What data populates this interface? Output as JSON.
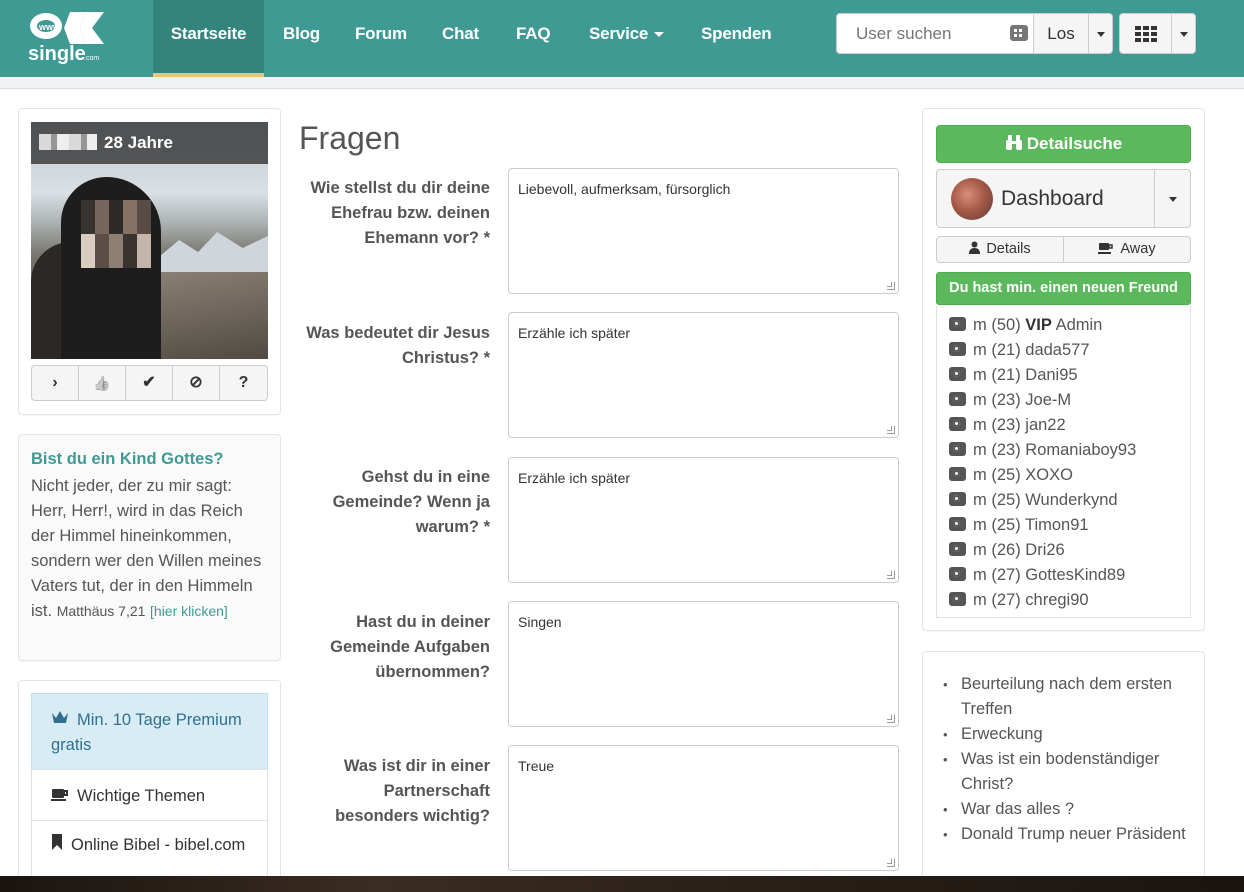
{
  "nav": {
    "logo_text": "single",
    "logo_badge": "www",
    "logo_suffix": ".com",
    "items": [
      {
        "label": "Startseite",
        "active": true
      },
      {
        "label": "Blog"
      },
      {
        "label": "Forum"
      },
      {
        "label": "Chat"
      },
      {
        "label": "FAQ"
      },
      {
        "label": "Service"
      },
      {
        "label": "Spenden"
      }
    ],
    "search": {
      "placeholder": "User suchen",
      "button": "Los"
    }
  },
  "profile": {
    "age": "28 Jahre",
    "actions": [
      "›",
      "👍",
      "✔",
      "⊘",
      "?"
    ]
  },
  "bible": {
    "title": "Bist du ein Kind Gottes?",
    "text": "Nicht jeder, der zu mir sagt: Herr, Herr!, wird in das Reich der Himmel hineinkommen, sondern wer den Willen meines Vaters tut, der in den Himmeln ist.",
    "reference": "Matthäus 7,21",
    "link": "[hier klicken]"
  },
  "menu": {
    "items": [
      {
        "icon": "crown-icon",
        "label": "Min. 10 Tage Premium gratis"
      },
      {
        "icon": "coffee-icon",
        "label": "Wichtige Themen"
      },
      {
        "icon": "bookmark-icon",
        "label": "Online Bibel - bibel.com"
      }
    ]
  },
  "main": {
    "title": "Fragen",
    "questions": [
      {
        "label": "Wie stellst du dir deine Ehefrau bzw. deinen Ehemann vor? *",
        "answer": "Liebevoll, aufmerksam, fürsorglich"
      },
      {
        "label": "Was bedeutet dir Jesus Christus? *",
        "answer": "Erzähle ich später"
      },
      {
        "label": "Gehst du in eine Gemeinde? Wenn ja warum? *",
        "answer": "Erzähle ich später"
      },
      {
        "label": "Hast du in deiner Gemeinde Aufgaben übernommen?",
        "answer": "Singen"
      },
      {
        "label": "Was ist dir in einer Partnerschaft besonders wichtig?",
        "answer": "Treue"
      }
    ]
  },
  "sidebar": {
    "detail_search": "Detailsuche",
    "dashboard": "Dashboard",
    "details_btn": "Details",
    "away_btn": "Away",
    "new_friend": "Du hast min. einen neuen Freund",
    "friends": [
      {
        "gender": "m",
        "age": "(50)",
        "vip": "VIP",
        "name": "Admin"
      },
      {
        "gender": "m",
        "age": "(21)",
        "vip": "",
        "name": "dada577"
      },
      {
        "gender": "m",
        "age": "(21)",
        "vip": "",
        "name": "Dani95"
      },
      {
        "gender": "m",
        "age": "(23)",
        "vip": "",
        "name": "Joe-M"
      },
      {
        "gender": "m",
        "age": "(23)",
        "vip": "",
        "name": "jan22"
      },
      {
        "gender": "m",
        "age": "(23)",
        "vip": "",
        "name": "Romaniaboy93"
      },
      {
        "gender": "m",
        "age": "(25)",
        "vip": "",
        "name": "XOXO"
      },
      {
        "gender": "m",
        "age": "(25)",
        "vip": "",
        "name": "Wunderkynd"
      },
      {
        "gender": "m",
        "age": "(25)",
        "vip": "",
        "name": "Timon91"
      },
      {
        "gender": "m",
        "age": "(26)",
        "vip": "",
        "name": "Dri26"
      },
      {
        "gender": "m",
        "age": "(27)",
        "vip": "",
        "name": "GottesKind89"
      },
      {
        "gender": "m",
        "age": "(27)",
        "vip": "",
        "name": "chregi90"
      }
    ],
    "topics": [
      "Beurteilung nach dem ersten Treffen",
      "Erweckung",
      "Was ist ein bodenständiger Christ?",
      "War das alles ?",
      "Donald Trump neuer Präsident"
    ]
  },
  "colors": {
    "brand": "#3f9a93",
    "accent": "#e6c871",
    "success": "#5cb85c"
  }
}
